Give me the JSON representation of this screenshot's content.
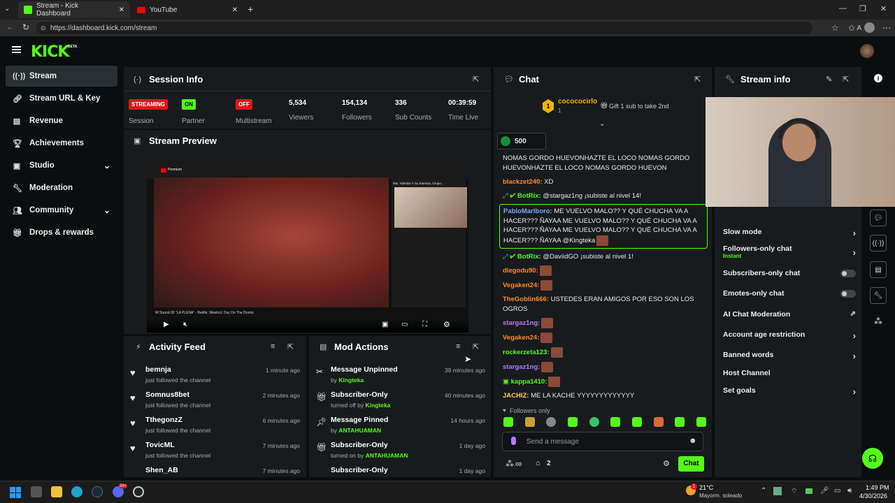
{
  "browser": {
    "tabs": [
      {
        "label": "Stream - Kick Dashboard"
      },
      {
        "label": "YouTube"
      }
    ],
    "url": "https://dashboard.kick.com/stream"
  },
  "app": {
    "logo": "KICK",
    "logo_badge": "BETA"
  },
  "sidebar": {
    "items": [
      {
        "label": "Stream",
        "icon": "broadcast-icon"
      },
      {
        "label": "Stream URL & Key",
        "icon": "link-icon"
      },
      {
        "label": "Revenue",
        "icon": "chart-icon"
      },
      {
        "label": "Achievements",
        "icon": "trophy-icon"
      },
      {
        "label": "Studio",
        "icon": "studio-icon"
      },
      {
        "label": "Moderation",
        "icon": "wrench-icon"
      },
      {
        "label": "Community",
        "icon": "people-icon"
      },
      {
        "label": "Drops & rewards",
        "icon": "gift-icon"
      }
    ]
  },
  "session": {
    "title": "Session Info",
    "stats": [
      {
        "badge": "STREAMING",
        "label": "Session"
      },
      {
        "badge": "ON",
        "label": "Partner"
      },
      {
        "badge": "OFF",
        "label": "Multistream"
      },
      {
        "value": "5,534",
        "label": "Viewers"
      },
      {
        "value": "154,134",
        "label": "Followers"
      },
      {
        "value": "336",
        "label": "Sub Counts"
      },
      {
        "value": "00:39:59",
        "label": "Time Live"
      }
    ]
  },
  "preview": {
    "title": "Stream Preview",
    "yt_brand": "Premium",
    "yt_mix": "Mix: Yahritza Y Su Esencia, Grupo...",
    "yt_now_playing": "W Sound 05 \"LA PLENA\" - Beélle, Westcol, Ovy On The Drums"
  },
  "activity": {
    "title": "Activity Feed",
    "items": [
      {
        "name": "bemnja",
        "sub": "just followed the channel",
        "time": "1 minute ago"
      },
      {
        "name": "Somnus8bet",
        "sub": "just followed the channel",
        "time": "2 minutes ago"
      },
      {
        "name": "TthegonzZ",
        "sub": "just followed the channel",
        "time": "6 minutes ago"
      },
      {
        "name": "TovicML",
        "sub": "just followed the channel",
        "time": "7 minutes ago"
      },
      {
        "name": "Shen_AB",
        "sub": "",
        "time": "7 minutes ago"
      }
    ]
  },
  "mod": {
    "title": "Mod Actions",
    "items": [
      {
        "name": "Message Unpinned",
        "prefix": "by ",
        "who": "Kingteka",
        "time": "39 minutes ago"
      },
      {
        "name": "Subscriber-Only",
        "prefix": "turned off by ",
        "who": "Kingteka",
        "time": "40 minutes ago"
      },
      {
        "name": "Message Pinned",
        "prefix": "by ",
        "who": "ANTAHUAMAN",
        "time": "14 hours ago"
      },
      {
        "name": "Subscriber-Only",
        "prefix": "turned on by ",
        "who": "ANTAHUAMAN",
        "time": "1 day ago"
      },
      {
        "name": "Subscriber-Only",
        "prefix": "",
        "who": "",
        "time": "1 day ago"
      }
    ]
  },
  "chat": {
    "title": "Chat",
    "gifter_name": "cocococirlo",
    "gifter_rank": "1",
    "gift_text": "Gift 1 sub to take 2nd",
    "kicks": "500",
    "messages": [
      {
        "user": "",
        "color": "#fff",
        "text": "NOMAS GORDO HUEVONHAZTE EL LOCO NOMAS GORDO HUEVONHAZTE EL LOCO NOMAS GORDO HUEVON"
      },
      {
        "user": "blackzet240:",
        "color": "#ff8a2a",
        "text": "XD"
      },
      {
        "user": "BotRix:",
        "color": "#53fc18",
        "text": "@stargaz1ng ¡subiste al nivel 14!"
      },
      {
        "user": "PabloMarlboro:",
        "color": "#7aa6ff",
        "text": "ME VUELVO MALO?? Y QUÉ CHUCHA VA A HACER??? ÑAYAA  ME VUELVO MALO?? Y QUÉ CHUCHA VA A HACER??? ÑAYAA  ME VUELVO MALO?? Y QUÉ CHUCHA VA A HACER??? ÑAYAA  @Kingteka"
      },
      {
        "user": "BotRix:",
        "color": "#53fc18",
        "text": "@DaviidGO ¡subiste al nivel 1!"
      },
      {
        "user": "diegodu90:",
        "color": "#ff8a2a",
        "text": ""
      },
      {
        "user": "Vegaken24:",
        "color": "#ff8a2a",
        "text": ""
      },
      {
        "user": "TheGoblin666:",
        "color": "#ff8a2a",
        "text": "USTEDES ERAN AMIGOS POR ESO SON LOS OGROS"
      },
      {
        "user": "stargaz1ng:",
        "color": "#b57aff",
        "text": ""
      },
      {
        "user": "Vegaken24:",
        "color": "#ff8a2a",
        "text": ""
      },
      {
        "user": "rockerzeta123:",
        "color": "#53fc18",
        "text": ""
      },
      {
        "user": "stargaz1ng:",
        "color": "#b57aff",
        "text": ""
      },
      {
        "user": "kappa1410:",
        "color": "#53fc18",
        "text": ""
      },
      {
        "user": "JACHIZ:",
        "color": "#ffd23f",
        "text": "ME LA KACHE YYYYYYYYYYYYY"
      }
    ],
    "followers_only": "Followers only",
    "placeholder": "Send a message",
    "count": "2",
    "send": "Chat"
  },
  "streaminfo": {
    "title": "Stream info",
    "settings": [
      {
        "label": "Slow mode",
        "sub": "",
        "control": "chevron"
      },
      {
        "label": "Followers-only chat",
        "sub": "Instant",
        "control": "chevron"
      },
      {
        "label": "Subscribers-only chat",
        "sub": "",
        "control": "toggle"
      },
      {
        "label": "Emotes-only chat",
        "sub": "",
        "control": "toggle"
      },
      {
        "label": "AI Chat Moderation",
        "sub": "",
        "control": "external"
      },
      {
        "label": "Account age restriction",
        "sub": "",
        "control": "chevron"
      },
      {
        "label": "Banned words",
        "sub": "",
        "control": "chevron"
      },
      {
        "label": "Host Channel",
        "sub": "",
        "control": "none"
      },
      {
        "label": "Set goals",
        "sub": "",
        "control": "chevron"
      }
    ]
  },
  "taskbar": {
    "temp": "21°C",
    "weather": "Mayorm. soleado",
    "time": "1:49 PM",
    "date": "4/30/2026",
    "weather_alert": "1",
    "notify_badge": "99+"
  },
  "colors": {
    "accent": "#53fc18",
    "panel": "#181b1d",
    "streaming": "#e0151b"
  }
}
